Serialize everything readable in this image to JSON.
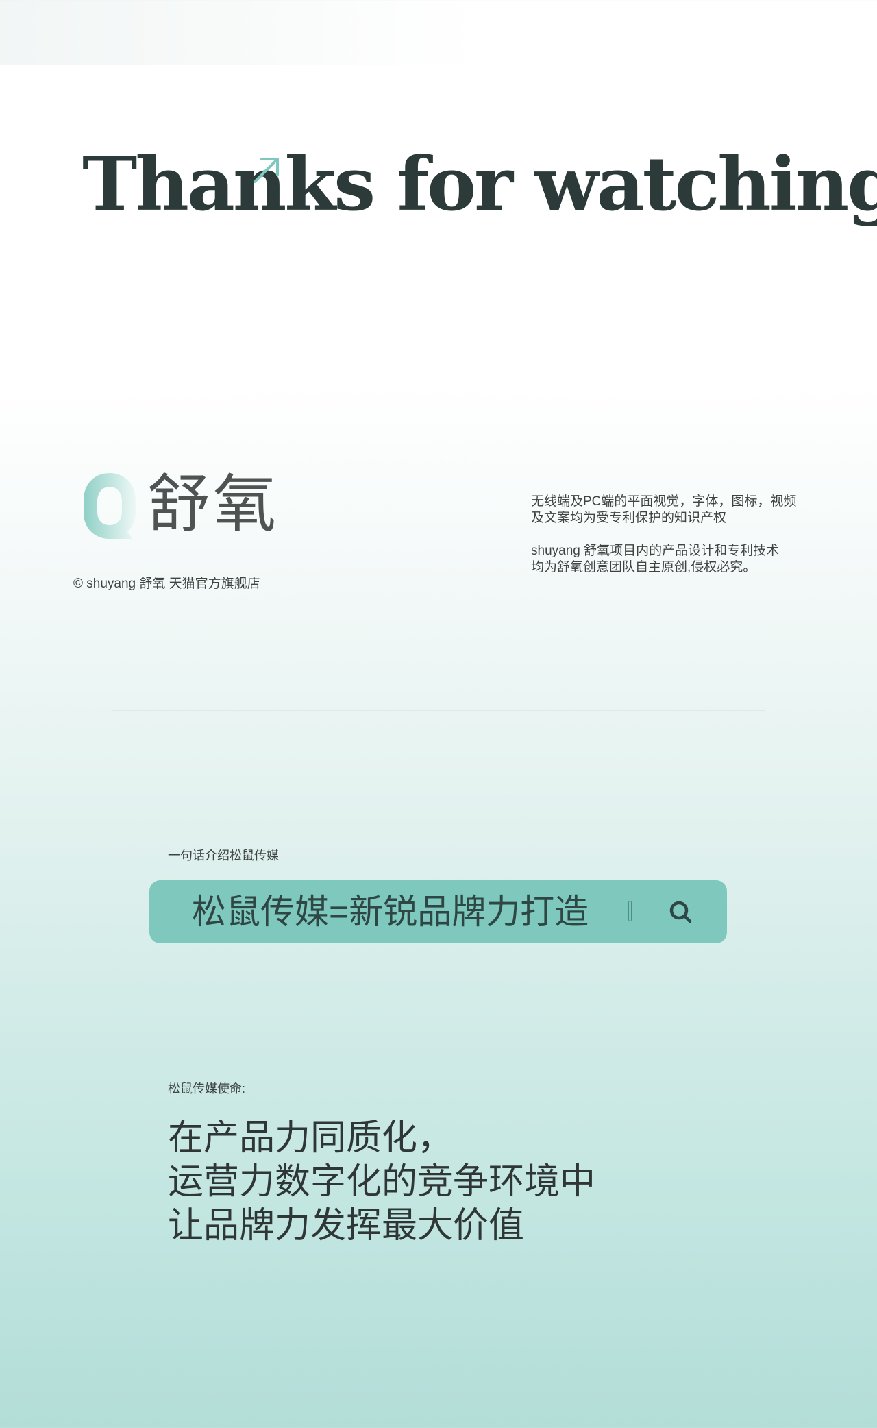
{
  "headline": "Thanks for watching",
  "brand": {
    "logo_text": "舒氧",
    "copyright": "© shuyang 舒氧  天猫官方旗舰店"
  },
  "legal": {
    "paragraph1": [
      "无线端及PC端的平面视觉，字体，图标，视频",
      "及文案均为受专利保护的知识产权"
    ],
    "paragraph2": [
      "shuyang 舒氧项目内的产品设计和专利技术",
      "均为舒氧创意团队自主原创,侵权必究。"
    ]
  },
  "intro": {
    "label": "一句话介绍松鼠传媒",
    "search_text": "松鼠传媒=新锐品牌力打造"
  },
  "mission": {
    "label": "松鼠传媒使命:",
    "lines": [
      "在产品力同质化，",
      "运营力数字化的竞争环境中",
      "让品牌力发挥最大价值"
    ]
  },
  "colors": {
    "accent": "#7ec8be",
    "headline": "#2c3b39",
    "logo_gradient_start": "#8fd0c6",
    "logo_gradient_end": "#eef8f6"
  },
  "icons": {
    "headline_accent": "arrow-up-right-icon",
    "search": "search-icon",
    "logo": "speech-bubble-logo-icon"
  }
}
